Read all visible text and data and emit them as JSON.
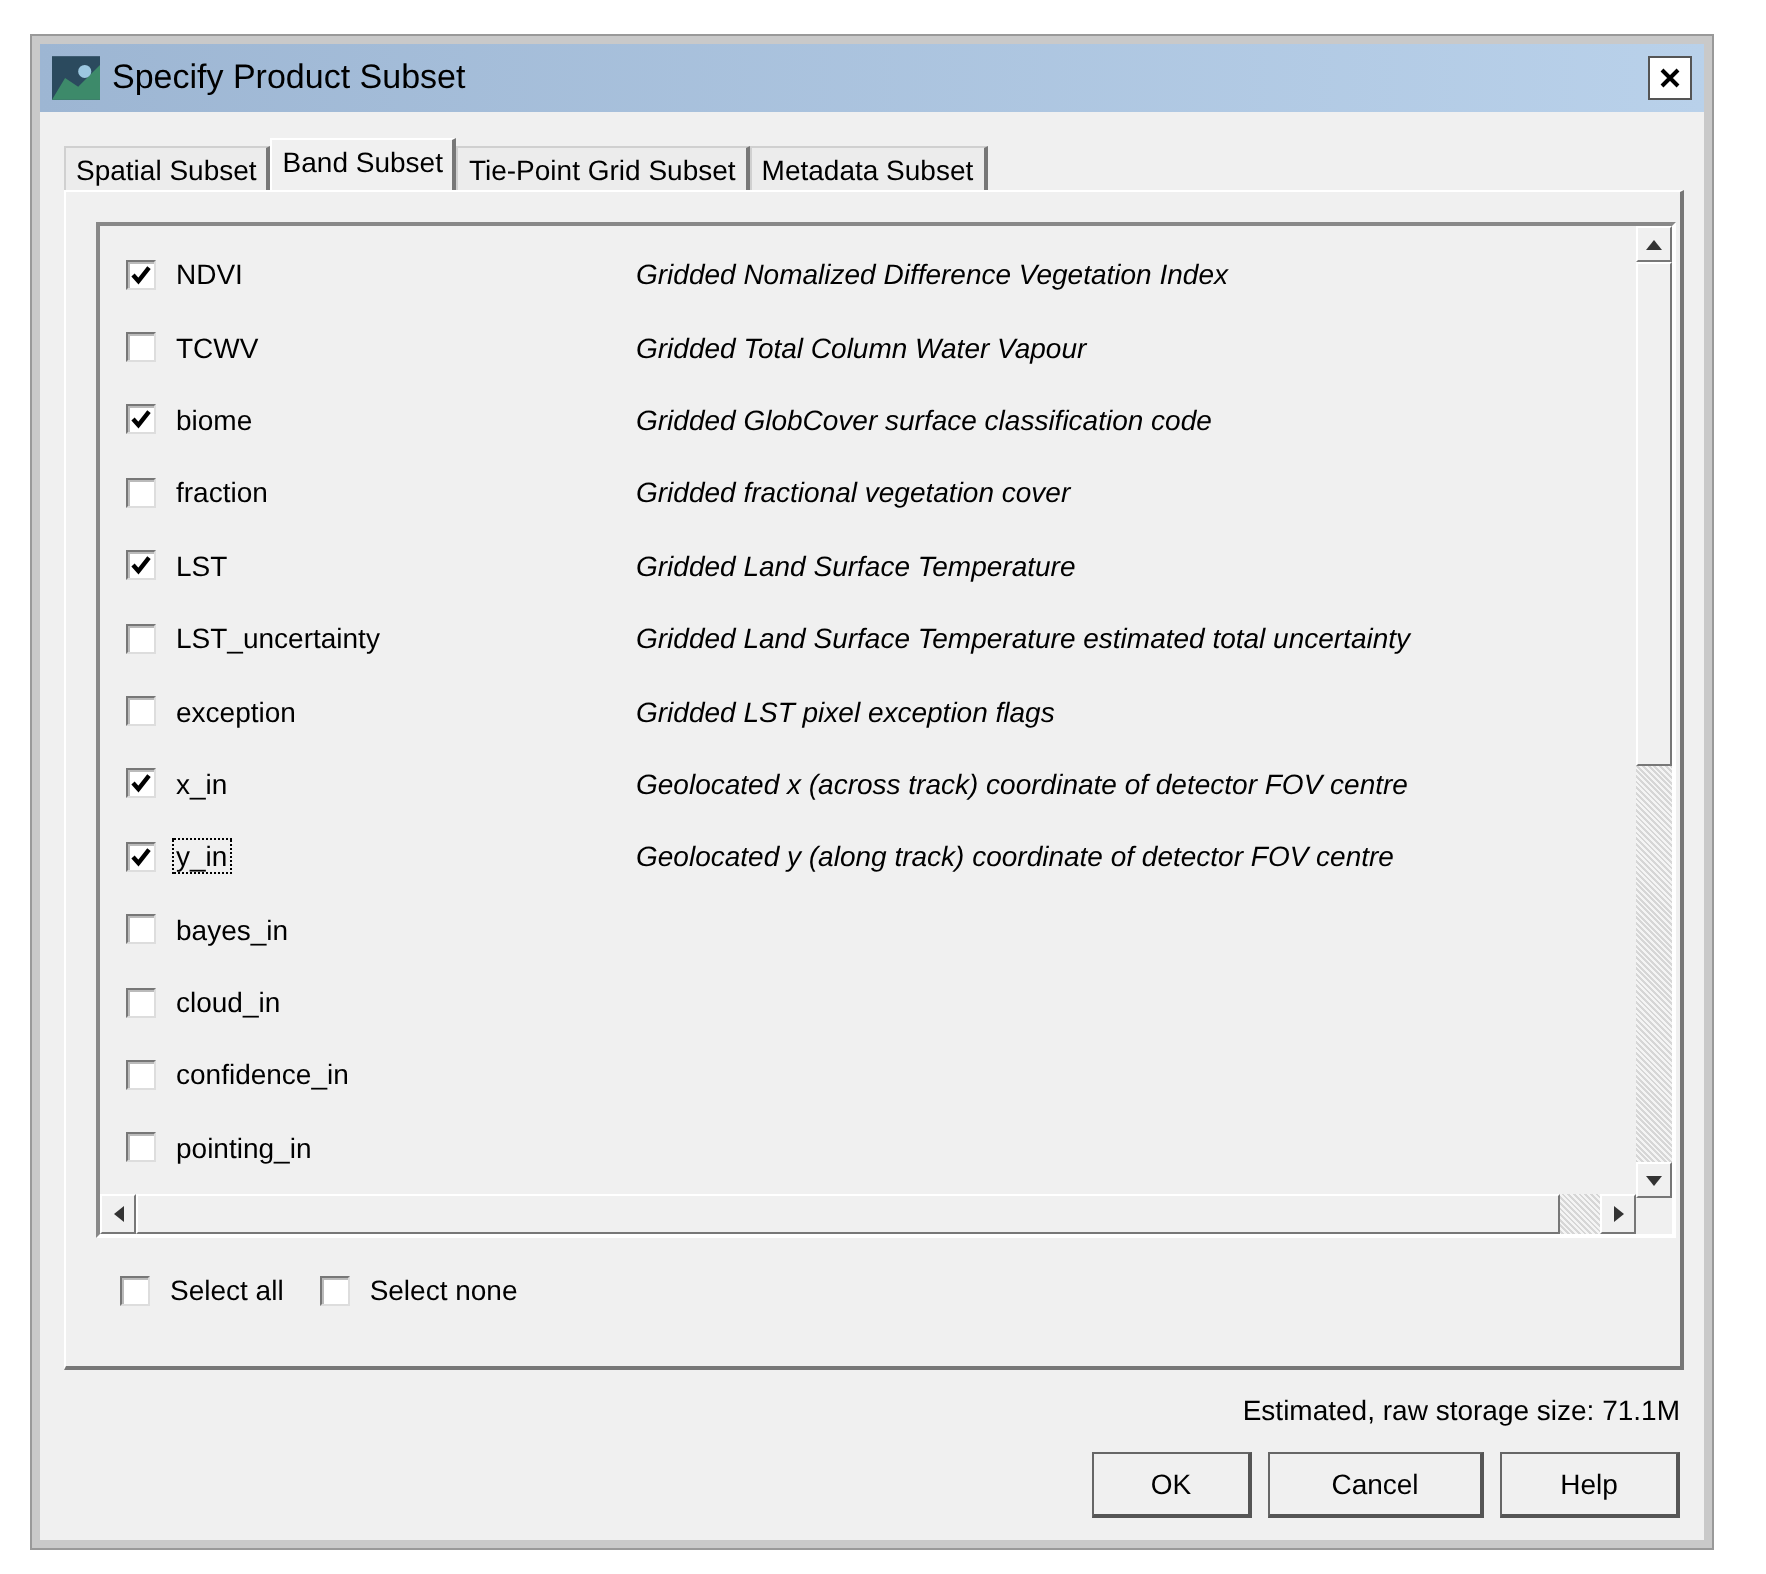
{
  "window": {
    "title": "Specify Product Subset"
  },
  "tabs": [
    {
      "label": "Spatial Subset",
      "selected": false
    },
    {
      "label": "Band Subset",
      "selected": true
    },
    {
      "label": "Tie-Point Grid Subset",
      "selected": false
    },
    {
      "label": "Metadata Subset",
      "selected": false
    }
  ],
  "bands": [
    {
      "name": "NDVI",
      "checked": true,
      "description": "Gridded Nomalized Difference Vegetation Index"
    },
    {
      "name": "TCWV",
      "checked": false,
      "description": "Gridded Total Column Water Vapour"
    },
    {
      "name": "biome",
      "checked": true,
      "description": "Gridded GlobCover surface classification code"
    },
    {
      "name": "fraction",
      "checked": false,
      "description": "Gridded fractional vegetation cover"
    },
    {
      "name": "LST",
      "checked": true,
      "description": "Gridded Land Surface Temperature"
    },
    {
      "name": "LST_uncertainty",
      "checked": false,
      "description": "Gridded Land Surface Temperature estimated total uncertainty"
    },
    {
      "name": "exception",
      "checked": false,
      "description": "Gridded LST pixel exception flags"
    },
    {
      "name": "x_in",
      "checked": true,
      "description": "Geolocated x (across track) coordinate of detector FOV centre"
    },
    {
      "name": "y_in",
      "checked": true,
      "focused": true,
      "description": "Geolocated y (along track) coordinate of detector FOV centre"
    },
    {
      "name": "bayes_in",
      "checked": false
    },
    {
      "name": "cloud_in",
      "checked": false
    },
    {
      "name": "confidence_in",
      "checked": false
    },
    {
      "name": "pointing_in",
      "checked": false
    }
  ],
  "select_options": [
    {
      "label": "Select all",
      "checked": false
    },
    {
      "label": "Select none",
      "checked": false
    }
  ],
  "storage_size": "Estimated, raw storage size: 71.1M",
  "buttons": [
    "OK",
    "Cancel",
    "Help"
  ]
}
